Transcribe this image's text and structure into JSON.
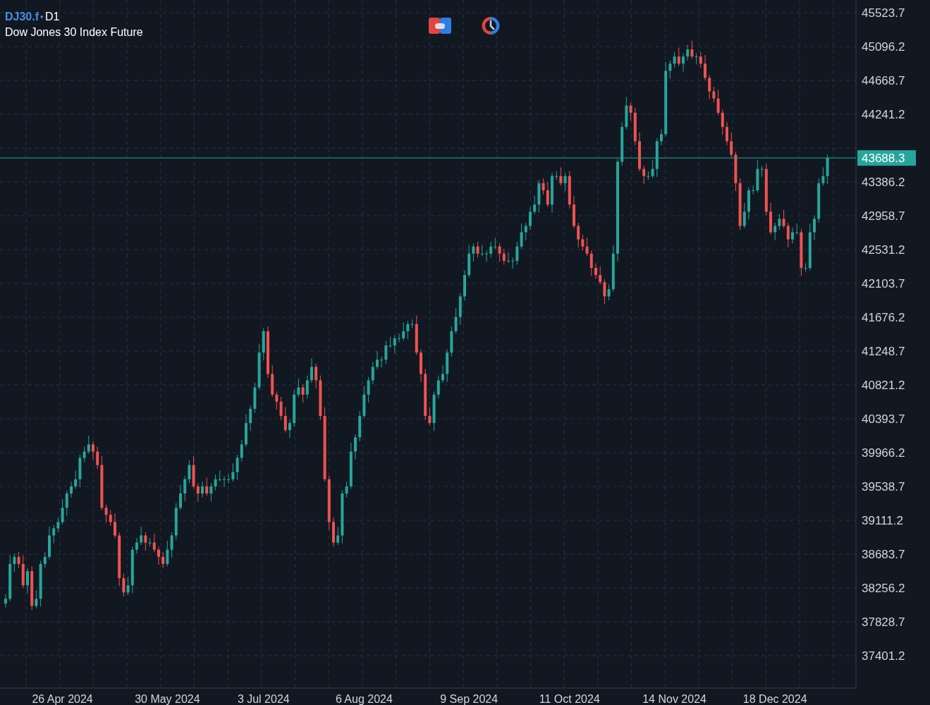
{
  "header": {
    "symbol": "DJ30.f",
    "menu_glyph": "▾",
    "timeframe": "D1",
    "name": "Dow Jones 30 Index Future"
  },
  "chart_data": {
    "type": "candlestick",
    "grid": true,
    "ylim": [
      36992,
      45684
    ],
    "ref_lines": [
      {
        "axis": "y",
        "value": 43688.3,
        "label": "43688.3",
        "color": "#26a69a"
      }
    ],
    "yticks": [
      45523.7,
      45096.2,
      44668.7,
      44241.2,
      43386.2,
      42958.7,
      42531.2,
      42103.7,
      41676.2,
      41248.7,
      40821.2,
      40393.7,
      39966.2,
      39538.7,
      39111.2,
      38683.7,
      38256.2,
      37828.7,
      37401.2
    ],
    "categories": [
      null,
      null,
      null,
      null,
      null,
      null,
      null,
      null,
      null,
      null,
      null,
      null,
      null,
      "26 Apr 2024",
      null,
      null,
      null,
      null,
      null,
      null,
      null,
      null,
      null,
      null,
      null,
      null,
      null,
      null,
      null,
      null,
      null,
      null,
      null,
      null,
      null,
      null,
      null,
      "30 May 2024",
      null,
      null,
      null,
      null,
      null,
      null,
      null,
      null,
      null,
      null,
      null,
      null,
      null,
      null,
      null,
      null,
      null,
      null,
      null,
      null,
      null,
      "3 Jul 2024",
      null,
      null,
      null,
      null,
      null,
      null,
      null,
      null,
      null,
      null,
      null,
      null,
      null,
      null,
      null,
      null,
      null,
      null,
      null,
      null,
      null,
      null,
      "6 Aug 2024",
      null,
      null,
      null,
      null,
      null,
      null,
      null,
      null,
      null,
      null,
      null,
      null,
      null,
      null,
      null,
      null,
      null,
      null,
      null,
      null,
      null,
      null,
      null,
      "9 Sep 2024",
      null,
      null,
      null,
      null,
      null,
      null,
      null,
      null,
      null,
      null,
      null,
      null,
      null,
      null,
      null,
      null,
      null,
      null,
      null,
      null,
      null,
      null,
      "11 Oct 2024",
      null,
      null,
      null,
      null,
      null,
      null,
      null,
      null,
      null,
      null,
      null,
      null,
      null,
      null,
      null,
      null,
      null,
      null,
      null,
      null,
      null,
      null,
      null,
      "14 Nov 2024",
      null,
      null,
      null,
      null,
      null,
      null,
      null,
      null,
      null,
      null,
      null,
      null,
      null,
      null,
      null,
      null,
      null,
      null,
      null,
      null,
      null,
      null,
      "18 Dec 2024",
      null,
      null,
      null,
      null,
      null,
      null,
      null,
      null,
      null,
      null,
      null,
      null
    ],
    "ohlc": [
      [
        38060,
        38180,
        38010,
        38120
      ],
      [
        38120,
        38670,
        38090,
        38560
      ],
      [
        38560,
        38690,
        38460,
        38650
      ],
      [
        38650,
        38710,
        38510,
        38560
      ],
      [
        38560,
        38670,
        38260,
        38290
      ],
      [
        38290,
        38510,
        38190,
        38470
      ],
      [
        38470,
        38530,
        37980,
        38030
      ],
      [
        38030,
        38230,
        38000,
        38120
      ],
      [
        38120,
        38600,
        38020,
        38560
      ],
      [
        38560,
        38710,
        38510,
        38650
      ],
      [
        38650,
        39030,
        38620,
        38920
      ],
      [
        38920,
        39050,
        38820,
        39010
      ],
      [
        39010,
        39150,
        38960,
        39090
      ],
      [
        39090,
        39380,
        39060,
        39270
      ],
      [
        39270,
        39490,
        39170,
        39450
      ],
      [
        39450,
        39600,
        39400,
        39540
      ],
      [
        39540,
        39740,
        39510,
        39630
      ],
      [
        39630,
        39940,
        39530,
        39900
      ],
      [
        39900,
        40040,
        39850,
        39980
      ],
      [
        39980,
        40180,
        39950,
        40070
      ],
      [
        40070,
        40110,
        39880,
        39980
      ],
      [
        39980,
        40040,
        39760,
        39810
      ],
      [
        39810,
        39920,
        39240,
        39270
      ],
      [
        39270,
        39310,
        39080,
        39180
      ],
      [
        39180,
        39240,
        39040,
        39090
      ],
      [
        39090,
        39200,
        38890,
        38920
      ],
      [
        38920,
        38960,
        38280,
        38380
      ],
      [
        38380,
        38440,
        38150,
        38200
      ],
      [
        38200,
        38400,
        38170,
        38290
      ],
      [
        38290,
        38780,
        38190,
        38740
      ],
      [
        38740,
        38890,
        38690,
        38830
      ],
      [
        38830,
        39030,
        38800,
        38920
      ],
      [
        38920,
        38960,
        38730,
        38830
      ],
      [
        38830,
        38890,
        38780,
        38830
      ],
      [
        38830,
        38940,
        38710,
        38740
      ],
      [
        38740,
        38780,
        38550,
        38650
      ],
      [
        38650,
        38710,
        38510,
        38560
      ],
      [
        38560,
        38850,
        38530,
        38740
      ],
      [
        38740,
        38960,
        38640,
        38920
      ],
      [
        38920,
        39330,
        38870,
        39270
      ],
      [
        39270,
        39560,
        39240,
        39450
      ],
      [
        39450,
        39670,
        39350,
        39630
      ],
      [
        39630,
        39870,
        39580,
        39810
      ],
      [
        39810,
        39920,
        39510,
        39540
      ],
      [
        39540,
        39580,
        39350,
        39450
      ],
      [
        39450,
        39600,
        39400,
        39540
      ],
      [
        39540,
        39650,
        39420,
        39450
      ],
      [
        39450,
        39580,
        39350,
        39540
      ],
      [
        39540,
        39690,
        39490,
        39630
      ],
      [
        39630,
        39740,
        39600,
        39630
      ],
      [
        39630,
        39670,
        39530,
        39630
      ],
      [
        39630,
        39690,
        39580,
        39630
      ],
      [
        39630,
        39830,
        39600,
        39720
      ],
      [
        39720,
        39940,
        39620,
        39900
      ],
      [
        39900,
        40130,
        39850,
        40070
      ],
      [
        40070,
        40450,
        40040,
        40340
      ],
      [
        40340,
        40560,
        40240,
        40520
      ],
      [
        40520,
        40850,
        40470,
        40790
      ],
      [
        40790,
        41340,
        40760,
        41230
      ],
      [
        41230,
        41540,
        41130,
        41500
      ],
      [
        41500,
        41560,
        40910,
        40960
      ],
      [
        40960,
        41070,
        40670,
        40700
      ],
      [
        40700,
        40740,
        40510,
        40610
      ],
      [
        40610,
        40670,
        40380,
        40430
      ],
      [
        40430,
        40540,
        40220,
        40250
      ],
      [
        40250,
        40380,
        40150,
        40340
      ],
      [
        40340,
        40760,
        40290,
        40700
      ],
      [
        40700,
        40900,
        40670,
        40790
      ],
      [
        40790,
        40830,
        40600,
        40700
      ],
      [
        40700,
        40940,
        40650,
        40880
      ],
      [
        40880,
        41160,
        40850,
        41050
      ],
      [
        41050,
        41090,
        40780,
        40880
      ],
      [
        40880,
        40940,
        40380,
        40430
      ],
      [
        40430,
        40540,
        39600,
        39630
      ],
      [
        39630,
        39670,
        38990,
        39090
      ],
      [
        39090,
        39150,
        38780,
        38830
      ],
      [
        38830,
        39030,
        38800,
        38920
      ],
      [
        38920,
        39490,
        38820,
        39450
      ],
      [
        39450,
        39600,
        39400,
        39540
      ],
      [
        39540,
        40090,
        39510,
        39980
      ],
      [
        39980,
        40200,
        39880,
        40160
      ],
      [
        40160,
        40490,
        40110,
        40430
      ],
      [
        40430,
        40810,
        40400,
        40700
      ],
      [
        40700,
        40920,
        40600,
        40880
      ],
      [
        40880,
        41110,
        40830,
        41050
      ],
      [
        41050,
        41250,
        41020,
        41140
      ],
      [
        41140,
        41180,
        41040,
        41140
      ],
      [
        41140,
        41380,
        41090,
        41320
      ],
      [
        41320,
        41430,
        41290,
        41320
      ],
      [
        41320,
        41450,
        41220,
        41410
      ],
      [
        41410,
        41470,
        41360,
        41410
      ],
      [
        41410,
        41610,
        41380,
        41500
      ],
      [
        41500,
        41630,
        41400,
        41590
      ],
      [
        41590,
        41650,
        41540,
        41590
      ],
      [
        41590,
        41700,
        41200,
        41230
      ],
      [
        41230,
        41270,
        40860,
        40960
      ],
      [
        40960,
        41020,
        40380,
        40430
      ],
      [
        40430,
        40540,
        40310,
        40340
      ],
      [
        40340,
        40740,
        40240,
        40700
      ],
      [
        40700,
        40940,
        40650,
        40880
      ],
      [
        40880,
        41070,
        40850,
        40960
      ],
      [
        40960,
        41270,
        40860,
        41230
      ],
      [
        41230,
        41560,
        41180,
        41500
      ],
      [
        41500,
        41790,
        41470,
        41680
      ],
      [
        41680,
        41980,
        41580,
        41940
      ],
      [
        41940,
        42270,
        41890,
        42210
      ],
      [
        42210,
        42590,
        42180,
        42480
      ],
      [
        42480,
        42610,
        42380,
        42570
      ],
      [
        42570,
        42630,
        42430,
        42480
      ],
      [
        42480,
        42590,
        42450,
        42480
      ],
      [
        42480,
        42520,
        42380,
        42480
      ],
      [
        42480,
        42630,
        42430,
        42570
      ],
      [
        42570,
        42680,
        42540,
        42570
      ],
      [
        42570,
        42610,
        42380,
        42480
      ],
      [
        42480,
        42540,
        42340,
        42390
      ],
      [
        42390,
        42500,
        42360,
        42390
      ],
      [
        42390,
        42430,
        42290,
        42390
      ],
      [
        42390,
        42630,
        42340,
        42570
      ],
      [
        42570,
        42860,
        42540,
        42750
      ],
      [
        42750,
        42870,
        42650,
        42830
      ],
      [
        42830,
        43070,
        42780,
        43010
      ],
      [
        43010,
        43210,
        42980,
        43100
      ],
      [
        43100,
        43410,
        43000,
        43370
      ],
      [
        43370,
        43430,
        43230,
        43280
      ],
      [
        43280,
        43390,
        43070,
        43100
      ],
      [
        43100,
        43500,
        43000,
        43460
      ],
      [
        43460,
        43520,
        43410,
        43460
      ],
      [
        43460,
        43570,
        43340,
        43370
      ],
      [
        43370,
        43500,
        43270,
        43460
      ],
      [
        43460,
        43520,
        43050,
        43100
      ],
      [
        43100,
        43210,
        42800,
        42830
      ],
      [
        42830,
        42870,
        42560,
        42660
      ],
      [
        42660,
        42720,
        42520,
        42570
      ],
      [
        42570,
        42680,
        42450,
        42480
      ],
      [
        42480,
        42520,
        42200,
        42300
      ],
      [
        42300,
        42360,
        42160,
        42210
      ],
      [
        42210,
        42320,
        42090,
        42120
      ],
      [
        42120,
        42160,
        41840,
        41940
      ],
      [
        41940,
        42090,
        41890,
        42030
      ],
      [
        42030,
        42590,
        42000,
        42480
      ],
      [
        42480,
        43680,
        42380,
        43640
      ],
      [
        43640,
        44140,
        43590,
        44080
      ],
      [
        44080,
        44460,
        44050,
        44350
      ],
      [
        44350,
        44390,
        44160,
        44260
      ],
      [
        44260,
        44320,
        43850,
        43900
      ],
      [
        43900,
        44010,
        43520,
        43550
      ],
      [
        43550,
        43590,
        43360,
        43460
      ],
      [
        43460,
        43520,
        43410,
        43460
      ],
      [
        43460,
        43660,
        43430,
        43550
      ],
      [
        43550,
        43940,
        43450,
        43900
      ],
      [
        43900,
        44050,
        43850,
        43990
      ],
      [
        43990,
        44900,
        43960,
        44790
      ],
      [
        44790,
        44920,
        44690,
        44880
      ],
      [
        44880,
        45030,
        44830,
        44970
      ],
      [
        44970,
        45080,
        44850,
        44880
      ],
      [
        44880,
        45010,
        44780,
        44970
      ],
      [
        44970,
        45120,
        44920,
        45060
      ],
      [
        45060,
        45170,
        44940,
        44970
      ],
      [
        44970,
        45010,
        44870,
        44970
      ],
      [
        44970,
        45030,
        44830,
        44880
      ],
      [
        44880,
        44990,
        44670,
        44700
      ],
      [
        44700,
        44740,
        44430,
        44530
      ],
      [
        44530,
        44590,
        44390,
        44440
      ],
      [
        44440,
        44550,
        44230,
        44260
      ],
      [
        44260,
        44300,
        43980,
        44080
      ],
      [
        44080,
        44140,
        43850,
        43900
      ],
      [
        43900,
        44010,
        43700,
        43730
      ],
      [
        43730,
        43770,
        43270,
        43370
      ],
      [
        43370,
        43430,
        42780,
        42830
      ],
      [
        42830,
        43120,
        42800,
        43010
      ],
      [
        43010,
        43320,
        42910,
        43280
      ],
      [
        43280,
        43340,
        43230,
        43280
      ],
      [
        43280,
        43660,
        43250,
        43550
      ],
      [
        43550,
        43590,
        43450,
        43550
      ],
      [
        43550,
        43610,
        42960,
        43010
      ],
      [
        43010,
        43120,
        42720,
        42750
      ],
      [
        42750,
        42870,
        42650,
        42830
      ],
      [
        42830,
        42980,
        42780,
        42920
      ],
      [
        42920,
        43030,
        42800,
        42830
      ],
      [
        42830,
        42870,
        42560,
        42660
      ],
      [
        42660,
        42810,
        42610,
        42750
      ],
      [
        42750,
        42860,
        42720,
        42750
      ],
      [
        42750,
        42790,
        42200,
        42300
      ],
      [
        42300,
        42360,
        42250,
        42300
      ],
      [
        42300,
        42860,
        42270,
        42750
      ],
      [
        42750,
        42960,
        42650,
        42920
      ],
      [
        42920,
        43430,
        42870,
        43370
      ],
      [
        43370,
        43570,
        43340,
        43460
      ],
      [
        43460,
        43730,
        43360,
        43690
      ]
    ]
  }
}
